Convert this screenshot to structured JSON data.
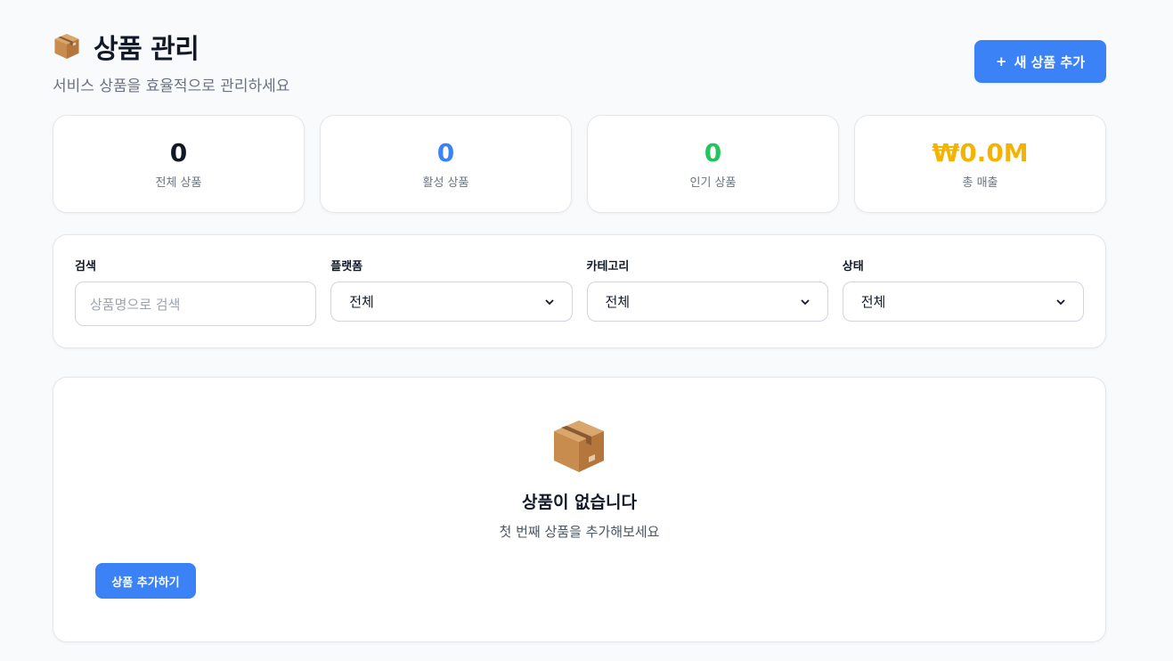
{
  "header": {
    "title": "상품 관리",
    "subtitle": "서비스 상품을 효율적으로 관리하세요",
    "add_button_icon": "+",
    "add_button_label": "새 상품 추가",
    "icon": "package-icon"
  },
  "stats": [
    {
      "value": "0",
      "label": "전체 상품",
      "color": "#111827"
    },
    {
      "value": "0",
      "label": "활성 상품",
      "color": "#3b82f6"
    },
    {
      "value": "0",
      "label": "인기 상품",
      "color": "#22c55e"
    },
    {
      "value": "₩0.0M",
      "label": "총 매출",
      "color": "#f5b301"
    }
  ],
  "filters": {
    "search": {
      "label": "검색",
      "placeholder": "상품명으로 검색"
    },
    "platform": {
      "label": "플랫폼",
      "value": "전체"
    },
    "category": {
      "label": "카테고리",
      "value": "전체"
    },
    "status": {
      "label": "상태",
      "value": "전체"
    }
  },
  "empty_state": {
    "icon": "package-icon",
    "title": "상품이 없습니다",
    "description": "첫 번째 상품을 추가해보세요",
    "button_label": "상품 추가하기"
  },
  "colors": {
    "accent": "#3b82f6",
    "background": "#f8fafc"
  }
}
